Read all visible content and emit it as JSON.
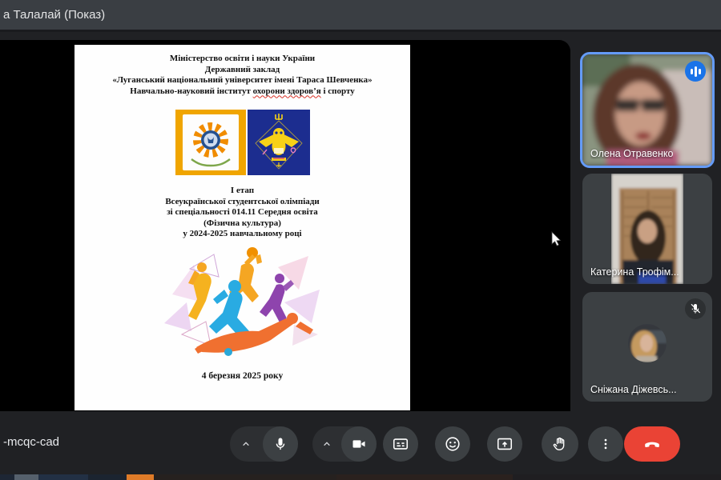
{
  "window": {
    "presenter_banner": "а Талалай (Показ)"
  },
  "shared_doc": {
    "header": [
      "Міністерство освіти і науки України",
      "Державний заклад",
      "«Луганський національний університет імені Тараса Шевченка»"
    ],
    "institute_prefix": "Навчально-науковий інститут ",
    "institute_underlined": "охорони здоров’я",
    "institute_suffix": " і спорту",
    "event_lines": [
      "І етап",
      "Всеукраїнської студентської олімпіади",
      "зі спеціальності 014.11 Середня освіта",
      "(Фізична культура)",
      "у 2024-2025 навчальному році"
    ],
    "date": "4 березня  2025 року",
    "logos": [
      "university-emblem-yellow",
      "institute-owl-emblem-navy"
    ],
    "illustration": "abstract-athletes-artwork"
  },
  "participants": [
    {
      "name": "Олена Отравенко",
      "status": "speaking",
      "indicator": "audio-waves-icon"
    },
    {
      "name": "Катерина Трофім...",
      "status": "camera-on",
      "indicator": ""
    },
    {
      "name": "Сніжана Діжевсь...",
      "status": "muted",
      "indicator": "mic-off-icon"
    }
  ],
  "call_bar": {
    "meeting_code": "-mcqc-cad",
    "controls": [
      {
        "id": "mic-options",
        "icon": "chevron-up-icon"
      },
      {
        "id": "mic-toggle",
        "icon": "microphone-icon"
      },
      {
        "id": "camera-options",
        "icon": "chevron-up-icon"
      },
      {
        "id": "camera-toggle",
        "icon": "video-camera-icon"
      },
      {
        "id": "captions-toggle",
        "icon": "captions-icon"
      },
      {
        "id": "reactions",
        "icon": "smiley-icon"
      },
      {
        "id": "present-screen",
        "icon": "present-screen-icon"
      },
      {
        "id": "raise-hand",
        "icon": "hand-icon"
      },
      {
        "id": "more-options",
        "icon": "three-dots-icon"
      },
      {
        "id": "end-call",
        "icon": "phone-hangup-icon"
      }
    ]
  },
  "colors": {
    "accent_blue": "#1a73e8",
    "active_speaker_border": "#649bf8",
    "end_call_red": "#ea4335",
    "tile_bg": "#3c4043",
    "topbar_bg": "#3a3e43",
    "page_bg": "#202124",
    "doc_bg": "#fefefe",
    "spellcheck_red": "#d93025",
    "logo_yellow": "#f0a500",
    "logo_navy": "#1c2d8f"
  }
}
